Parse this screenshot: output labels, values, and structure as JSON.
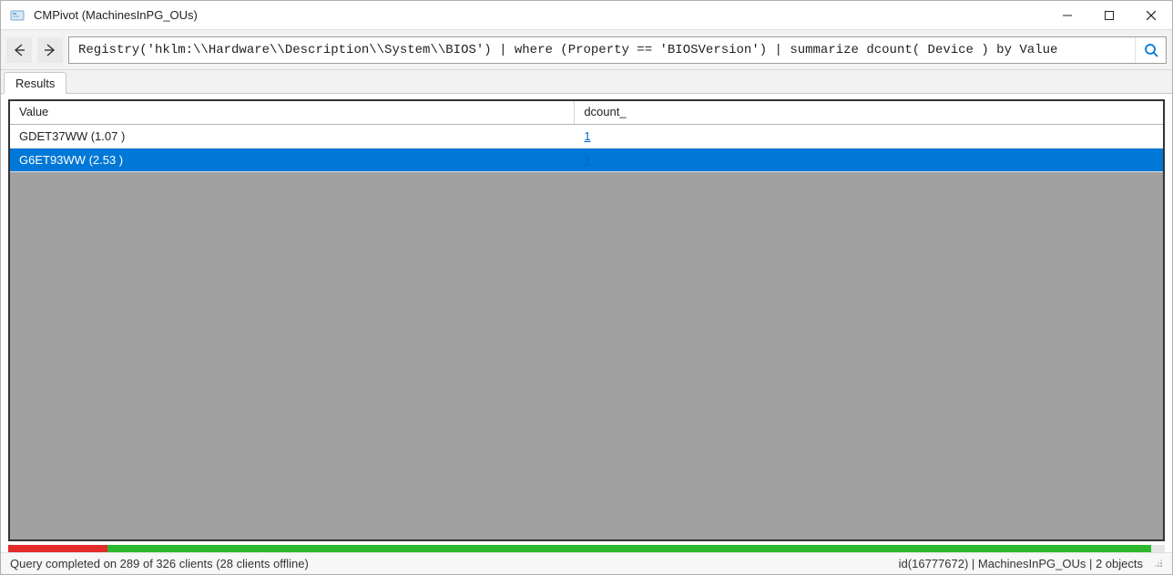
{
  "titlebar": {
    "title": "CMPivot (MachinesInPG_OUs)"
  },
  "toolbar": {
    "query": "Registry('hklm:\\\\Hardware\\\\Description\\\\System\\\\BIOS') | where (Property == 'BIOSVersion') | summarize dcount( Device ) by Value"
  },
  "tabs": {
    "results": "Results"
  },
  "grid": {
    "headers": {
      "value": "Value",
      "dcount": "dcount_"
    },
    "rows": [
      {
        "value": "GDET37WW (1.07 )",
        "dcount": "1",
        "selected": false
      },
      {
        "value": "G6ET93WW (2.53 )",
        "dcount": "1",
        "selected": true
      }
    ]
  },
  "progress": {
    "red_start_pct": 0,
    "red_end_pct": 8.6,
    "green_start_pct": 8.6,
    "green_end_pct": 98.8
  },
  "status": {
    "left": "Query completed on 289 of 326 clients (28 clients offline)",
    "right": "id(16777672)  |  MachinesInPG_OUs  |  2 objects"
  },
  "colors": {
    "selection": "#0078d7",
    "link": "#0066cc",
    "progress_red": "#e32b2b",
    "progress_green": "#2db82d"
  }
}
